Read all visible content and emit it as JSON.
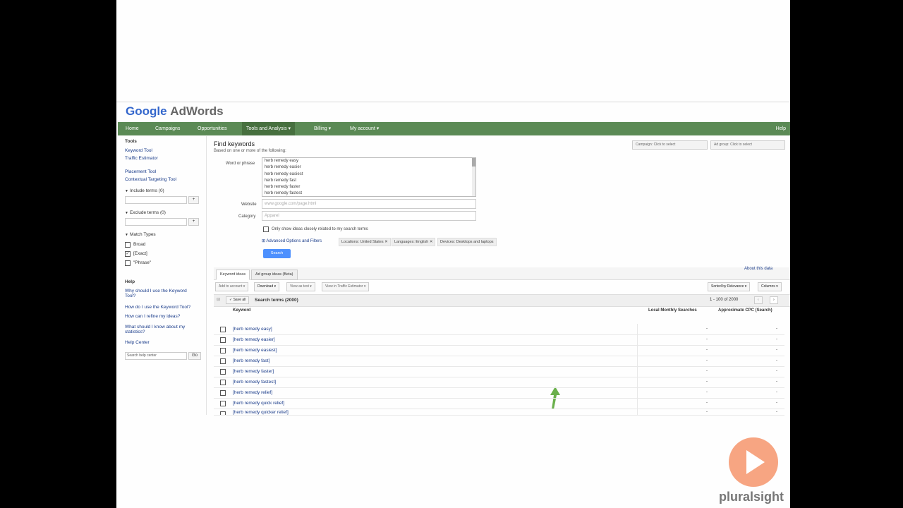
{
  "brand": {
    "logo_google": "Google",
    "logo_product": "AdWords"
  },
  "nav": {
    "items": [
      "Home",
      "Campaigns",
      "Opportunities",
      "Tools and Analysis ▾",
      "Billing ▾",
      "My account ▾"
    ],
    "help": "Help"
  },
  "sidebar": {
    "tools_title": "Tools",
    "links": [
      "Keyword Tool",
      "Traffic Estimator",
      "Placement Tool",
      "Contextual Targeting Tool"
    ],
    "include_terms": "Include terms (0)",
    "exclude_terms": "Exclude terms (0)",
    "match_types": "Match Types",
    "broad": "Broad",
    "exact": "[Exact]",
    "phrase": "\"Phrase\"",
    "help_title": "Help",
    "help_links": [
      "Why should I use the Keyword Tool?",
      "How do I use the Keyword Tool?",
      "How can I refine my ideas?",
      "What should I know about my statistics?",
      "Help Center"
    ],
    "search_placeholder": "Search help center",
    "go": "Go",
    "plus": "+"
  },
  "main": {
    "title": "Find keywords",
    "subtitle": "Based on one or more of the following:",
    "word_label": "Word or phrase",
    "words": [
      "herb remedy easy",
      "herb remedy easier",
      "herb remedy easiest",
      "herb remedy fast",
      "herb remedy faster",
      "herb remedy fastest"
    ],
    "website_label": "Website",
    "website_placeholder": "www.google.com/page.html",
    "category_label": "Category",
    "category_placeholder": "Apparel",
    "only_closely": "Only show ideas closely related to my search terms",
    "advanced": "Advanced Options and Filters",
    "chips": [
      "Locations: United States ✕",
      "Languages: English ✕",
      "Devices: Desktops and laptops"
    ],
    "search_btn": "Search",
    "campaign_select": "Campaign: Click to select",
    "adgroup_select": "Ad group: Click to select",
    "tabs": [
      "Keyword ideas",
      "Ad group ideas (Beta)"
    ],
    "about_data": "About this data",
    "toolbar": [
      "Add to account ▾",
      "Download ▾",
      "View as text ▾",
      "View in Traffic Estimator ▾"
    ],
    "sorted_by": "Sorted by Relevance ▾",
    "columns": "Columns ▾",
    "save_all": "✓ Save all",
    "search_terms": "Search terms (2000)",
    "pagination": "1 - 100 of 2000",
    "col_keyword": "Keyword",
    "col_local": "Local Monthly Searches",
    "col_cpc": "Approximate CPC (Search)",
    "rows": [
      {
        "kw": "[herb remedy easy]",
        "v1": "-",
        "v2": "-"
      },
      {
        "kw": "[herb remedy easier]",
        "v1": "-",
        "v2": "-"
      },
      {
        "kw": "[herb remedy easiest]",
        "v1": "-",
        "v2": "-"
      },
      {
        "kw": "[herb remedy fast]",
        "v1": "-",
        "v2": "-"
      },
      {
        "kw": "[herb remedy faster]",
        "v1": "-",
        "v2": "-"
      },
      {
        "kw": "[herb remedy fastest]",
        "v1": "-",
        "v2": "-"
      },
      {
        "kw": "[herb remedy relief]",
        "v1": "-",
        "v2": "-"
      },
      {
        "kw": "[herb remedy quick relief]",
        "v1": "-",
        "v2": "-"
      },
      {
        "kw": "[herb remedy quicker relief]",
        "v1": "-",
        "v2": "-"
      }
    ]
  },
  "watermark": "pluralsight"
}
